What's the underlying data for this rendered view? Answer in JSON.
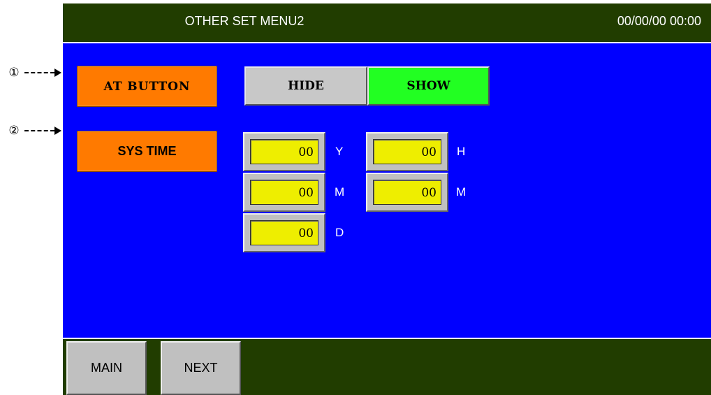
{
  "annotations": [
    {
      "marker": "①"
    },
    {
      "marker": "②"
    }
  ],
  "header": {
    "title": "OTHER SET MENU2",
    "clock": "00/00/00 00:00"
  },
  "at_button": {
    "label": "AT BUTTON",
    "options": {
      "hide": "HIDE",
      "show": "SHOW"
    },
    "selected": "SHOW"
  },
  "sys_time": {
    "label": "SYS TIME",
    "year": {
      "value": "00",
      "unit": "Y"
    },
    "month": {
      "value": "00",
      "unit": "M"
    },
    "day": {
      "value": "00",
      "unit": "D"
    },
    "hour": {
      "value": "00",
      "unit": "H"
    },
    "minute": {
      "value": "00",
      "unit": "M"
    }
  },
  "footer": {
    "main_label": "MAIN",
    "next_label": "NEXT"
  },
  "colors": {
    "screen_bg": "#0000ff",
    "bar_bg": "#213d00",
    "tag_bg": "#ff7a00",
    "show_active": "#22ff22",
    "hide_inactive": "#c8c8c8",
    "field_bg": "#eeee00"
  }
}
